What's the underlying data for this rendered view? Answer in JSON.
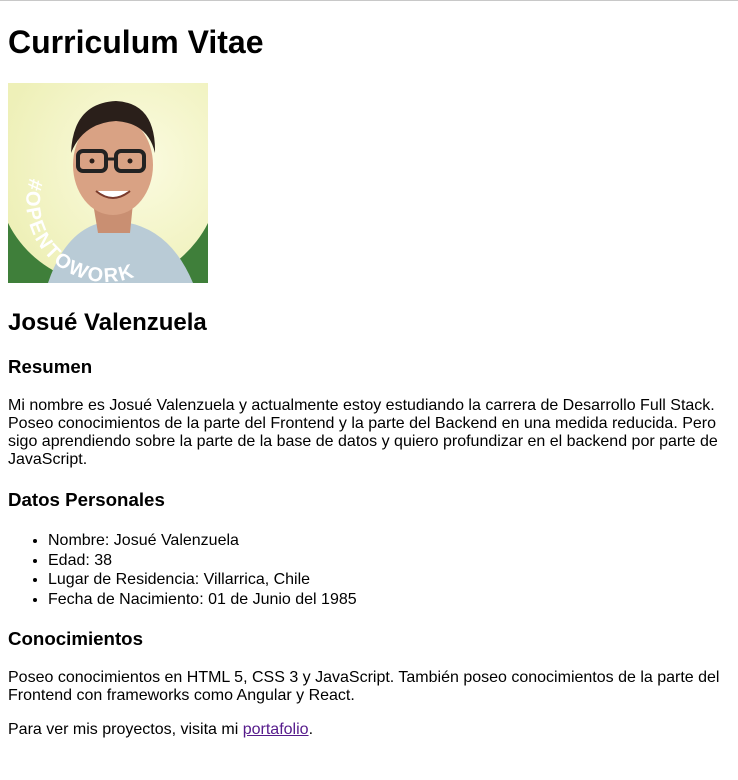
{
  "header": {
    "title": "Curriculum Vitae"
  },
  "photo": {
    "badge_text": "#OPENTOWORK",
    "badge_color": "#3f7f3a",
    "background_color": "#f7f6c9"
  },
  "profile": {
    "name": "Josué Valenzuela"
  },
  "resumen": {
    "heading": "Resumen",
    "text": "Mi nombre es Josué Valenzuela y actualmente estoy estudiando la carrera de Desarrollo Full Stack. Poseo conocimientos de la parte del Frontend y la parte del Backend en una medida reducida. Pero sigo aprendiendo sobre la parte de la base de datos y quiero profundizar en el backend por parte de JavaScript."
  },
  "datos": {
    "heading": "Datos Personales",
    "items": [
      "Nombre: Josué Valenzuela",
      "Edad: 38",
      "Lugar de Residencia: Villarrica, Chile",
      "Fecha de Nacimiento: 01 de Junio del 1985"
    ]
  },
  "conocimientos": {
    "heading": "Conocimientos",
    "text": "Poseo conocimientos en HTML 5, CSS 3 y JavaScript. También poseo conocimientos de la parte del Frontend con frameworks como Angular y React.",
    "portfolio_prefix": "Para ver mis proyectos, visita mi ",
    "portfolio_link": "portafolio",
    "portfolio_suffix": "."
  },
  "colors": {
    "link_visited": "#551a8b",
    "text": "#000000"
  }
}
